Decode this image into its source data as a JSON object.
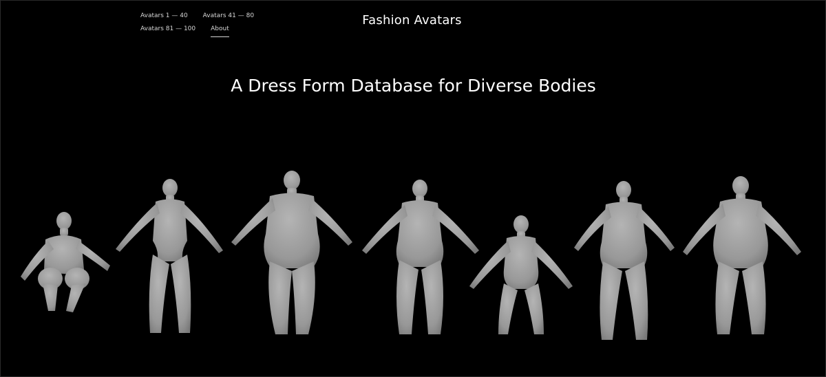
{
  "nav": {
    "links": [
      "Avatars 1 — 40",
      "Avatars 41 — 80",
      "Avatars 81 — 100",
      "About"
    ],
    "active": "About"
  },
  "site": {
    "title": "Fashion Avatars"
  },
  "hero": {
    "headline": "A Dress Form Database for Diverse Bodies"
  },
  "colors": {
    "background": "#000000",
    "text": "#ffffff",
    "avatar": "#9b9b9b"
  }
}
